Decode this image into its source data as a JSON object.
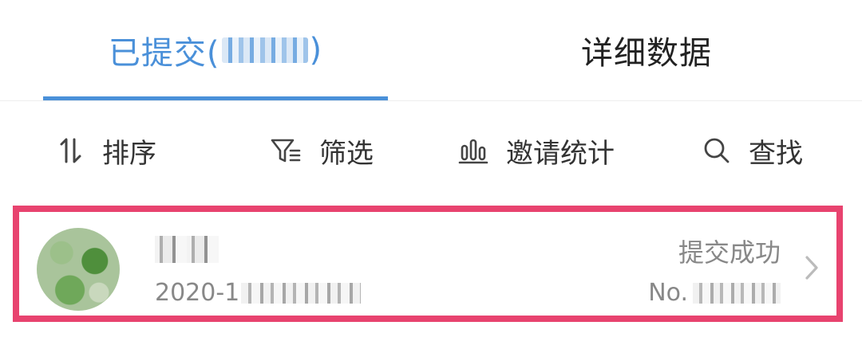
{
  "tabs": [
    {
      "label": "已提交(",
      "suffix": ")",
      "active": true
    },
    {
      "label": "详细数据",
      "active": false
    }
  ],
  "toolbar": {
    "sort": {
      "label": "排序",
      "icon": "sort-icon"
    },
    "filter": {
      "label": "筛选",
      "icon": "filter-icon"
    },
    "invite": {
      "label": "邀请统计",
      "icon": "bar-chart-icon"
    },
    "search": {
      "label": "查找",
      "icon": "search-icon"
    }
  },
  "submission": {
    "date_prefix": "2020-1",
    "status": "提交成功",
    "serial_prefix": "No. "
  },
  "colors": {
    "accent": "#4a90d9",
    "highlight": "#e8436f",
    "muted_text": "#888888"
  }
}
